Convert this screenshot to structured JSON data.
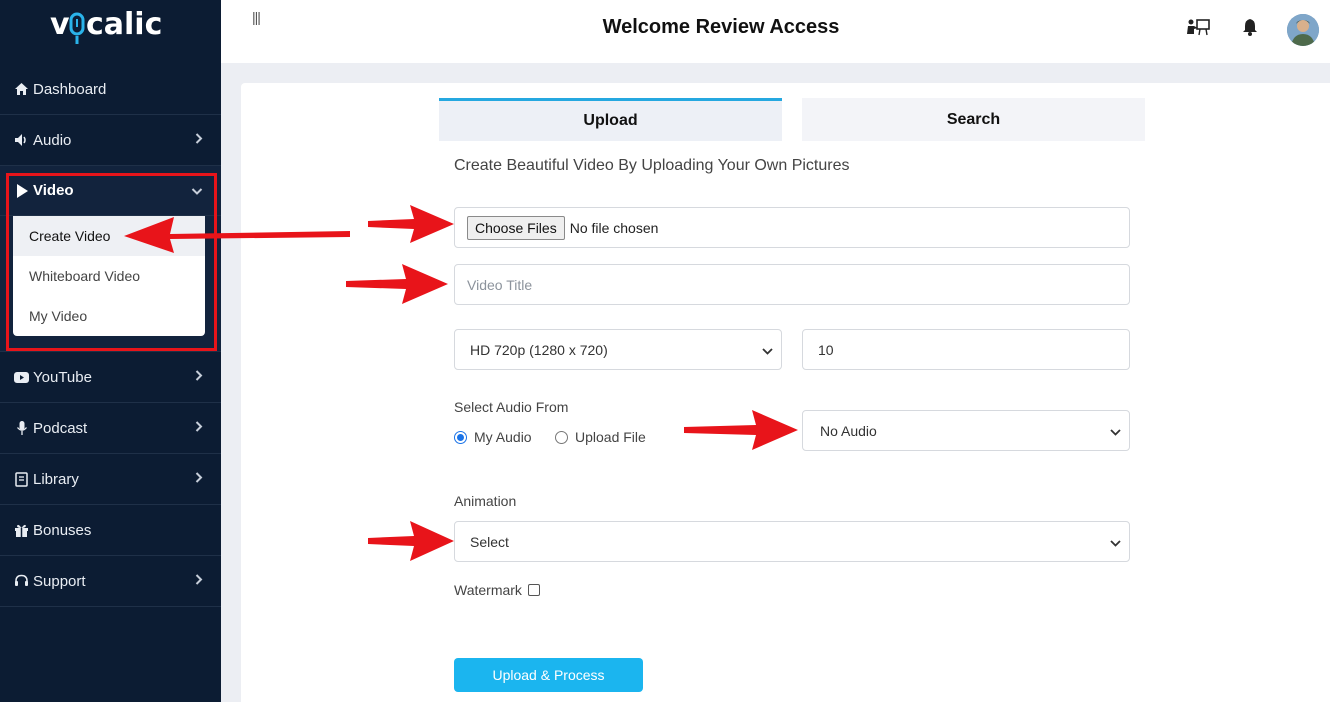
{
  "brand": {
    "logo_text": "vocalic"
  },
  "sidebar": {
    "items": [
      {
        "label": "Dashboard",
        "icon": "home-icon"
      },
      {
        "label": "Audio",
        "icon": "speaker-icon"
      },
      {
        "label": "Video",
        "icon": "play-icon"
      },
      {
        "label": "YouTube",
        "icon": "youtube-icon"
      },
      {
        "label": "Podcast",
        "icon": "microphone-icon"
      },
      {
        "label": "Library",
        "icon": "book-icon"
      },
      {
        "label": "Bonuses",
        "icon": "gift-icon"
      },
      {
        "label": "Support",
        "icon": "headset-icon"
      }
    ],
    "video_submenu": [
      {
        "label": "Create Video",
        "active": true
      },
      {
        "label": "Whiteboard Video"
      },
      {
        "label": "My Video"
      }
    ]
  },
  "header": {
    "title": "Welcome Review Access",
    "menu_glyph": "|||"
  },
  "tabs": [
    {
      "label": "Upload",
      "active": true
    },
    {
      "label": "Search"
    }
  ],
  "form": {
    "subtitle": "Create Beautiful Video By Uploading Your Own Pictures",
    "file_button": "Choose Files",
    "file_status": "No file chosen",
    "video_title_placeholder": "Video Title",
    "resolution_value": "HD 720p (1280 x 720)",
    "duration_value": "10",
    "audio_label": "Select Audio From",
    "radio_my_audio": "My Audio",
    "radio_upload_file": "Upload File",
    "audio_select_value": "No Audio",
    "animation_label": "Animation",
    "animation_value": "Select",
    "watermark_label": "Watermark",
    "submit_label": "Upload & Process"
  },
  "colors": {
    "sidebar_bg": "#0c1c33",
    "accent": "#25a8e0",
    "button": "#1bb5ef",
    "annotation_red": "#e8141a"
  }
}
